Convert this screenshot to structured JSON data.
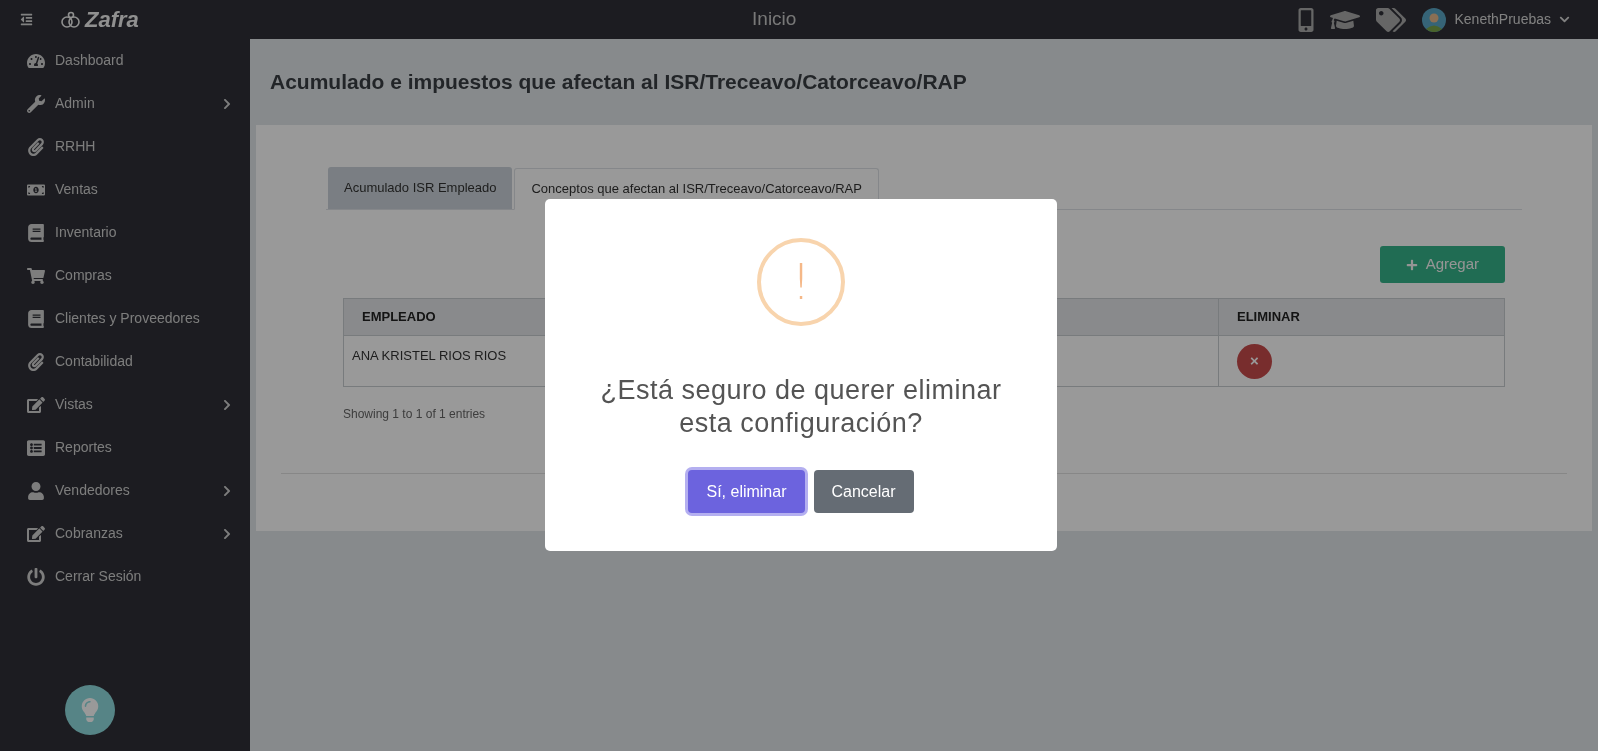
{
  "topbar": {
    "logo": "Zafra",
    "title": "Inicio",
    "user": "KenethPruebas"
  },
  "sidebar": {
    "items": [
      {
        "label": "Dashboard",
        "has_submenu": false
      },
      {
        "label": "Admin",
        "has_submenu": true
      },
      {
        "label": "RRHH",
        "has_submenu": false
      },
      {
        "label": "Ventas",
        "has_submenu": false
      },
      {
        "label": "Inventario",
        "has_submenu": false
      },
      {
        "label": "Compras",
        "has_submenu": false
      },
      {
        "label": "Clientes y Proveedores",
        "has_submenu": false
      },
      {
        "label": "Contabilidad",
        "has_submenu": false
      },
      {
        "label": "Vistas",
        "has_submenu": true
      },
      {
        "label": "Reportes",
        "has_submenu": false
      },
      {
        "label": "Vendedores",
        "has_submenu": true
      },
      {
        "label": "Cobranzas",
        "has_submenu": true
      },
      {
        "label": "Cerrar Sesión",
        "has_submenu": false
      }
    ]
  },
  "page": {
    "title": "Acumulado e impuestos que afectan al ISR/Treceavo/Catorceavo/RAP",
    "tabs": [
      {
        "label": "Acumulado ISR Empleado",
        "selected": false
      },
      {
        "label": "Conceptos que afectan al ISR/Treceavo/Catorceavo/RAP",
        "selected": true
      }
    ],
    "add_button": "Agregar",
    "table": {
      "columns": [
        "EMPLEADO",
        "ELIMINAR"
      ],
      "rows": [
        {
          "empleado": "ANA KRISTEL RIOS RIOS",
          "delete": "×"
        }
      ]
    },
    "footer": "Showing 1 to 1 of 1 entries"
  },
  "dialog": {
    "message": "¿Está seguro de querer eliminar esta configuración?",
    "icon_text": "!",
    "buttons": [
      {
        "label": "Sí, eliminar",
        "kind": "confirm"
      },
      {
        "label": "Cancelar",
        "kind": "cancel"
      }
    ]
  }
}
